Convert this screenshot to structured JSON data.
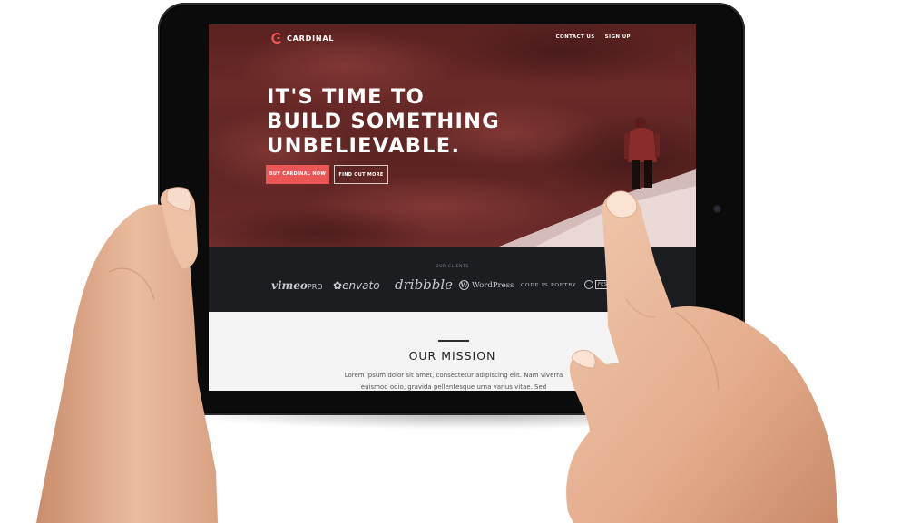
{
  "brand": {
    "name": "CARDINAL",
    "accent": "#e95757"
  },
  "nav": {
    "items": [
      "CONTACT US",
      "SIGN UP"
    ]
  },
  "hero": {
    "headline_lines": [
      "IT'S TIME TO",
      "BUILD SOMETHING",
      "UNBELIEVABLE."
    ],
    "primary_button": "BUY CARDINAL NOW",
    "secondary_button": "FIND OUT MORE"
  },
  "clients": {
    "label": "OUR CLIENTS",
    "logos": {
      "vimeo": "vimeo",
      "vimeo_suffix": "PRO",
      "envato": "envato",
      "dribbble": "dribbble",
      "wordpress": "WordPress",
      "wordpress_mark": "W",
      "code_is_poetry": "CODE IS POETRY",
      "festival": "FESTIVAL+A"
    }
  },
  "mission": {
    "title": "OUR MISSION",
    "body": "Lorem ipsum dolor sit amet, consectetur adipiscing elit. Nam viverra euismod odio, gravida pellentesque urna varius vitae. Sed"
  }
}
